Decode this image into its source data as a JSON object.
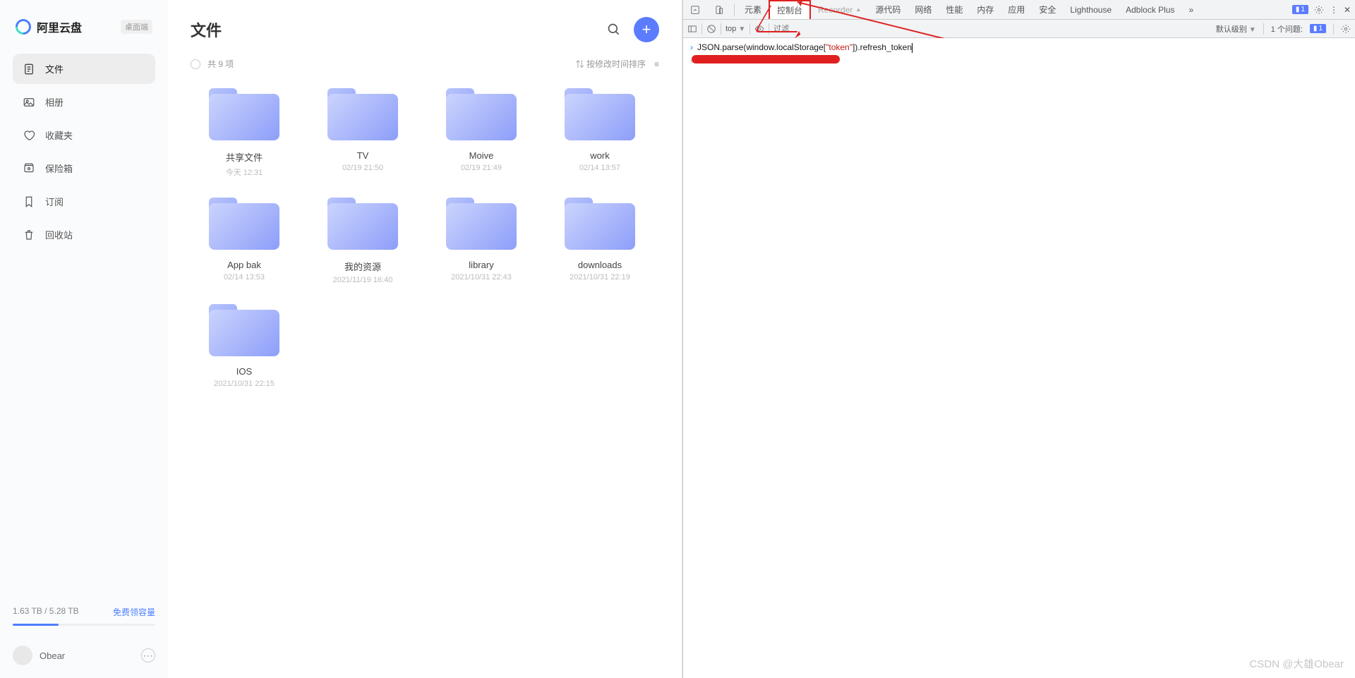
{
  "brand": {
    "name": "阿里云盘",
    "tag": "桌面端"
  },
  "sidebar": {
    "items": [
      {
        "label": "文件",
        "icon": "file"
      },
      {
        "label": "相册",
        "icon": "image"
      },
      {
        "label": "收藏夹",
        "icon": "heart"
      },
      {
        "label": "保险箱",
        "icon": "vault"
      },
      {
        "label": "订阅",
        "icon": "bookmark"
      },
      {
        "label": "回收站",
        "icon": "trash"
      }
    ]
  },
  "storage": {
    "text": "1.63 TB / 5.28 TB",
    "link": "免费领容量"
  },
  "user": {
    "name": "Obear"
  },
  "main": {
    "title": "文件",
    "count": "共 9 项",
    "sort": "按修改时间排序"
  },
  "folders": [
    {
      "name": "共享文件",
      "time": "今天 12:31"
    },
    {
      "name": "TV",
      "time": "02/19 21:50"
    },
    {
      "name": "Moive",
      "time": "02/19 21:49"
    },
    {
      "name": "work",
      "time": "02/14 13:57"
    },
    {
      "name": "App bak",
      "time": "02/14 13:53"
    },
    {
      "name": "我的资源",
      "time": "2021/11/19 16:40"
    },
    {
      "name": "library",
      "time": "2021/10/31 22:43"
    },
    {
      "name": "downloads",
      "time": "2021/10/31 22:19"
    },
    {
      "name": "IOS",
      "time": "2021/10/31 22:15"
    }
  ],
  "devtools": {
    "tabs": [
      "元素",
      "控制台",
      "Recorder",
      "源代码",
      "网络",
      "性能",
      "内存",
      "应用",
      "安全",
      "Lighthouse",
      "Adblock Plus"
    ],
    "badge": "1",
    "toolbar": {
      "context": "top",
      "filter": "过滤",
      "level": "默认级别",
      "issues_label": "1 个问题:",
      "issues_count": "1"
    },
    "console": {
      "cmd_pre": "JSON.parse(window.localStorage[",
      "cmd_str": "\"token\"",
      "cmd_post": "]).refresh_token"
    }
  },
  "watermark": "CSDN @大雄Obear"
}
